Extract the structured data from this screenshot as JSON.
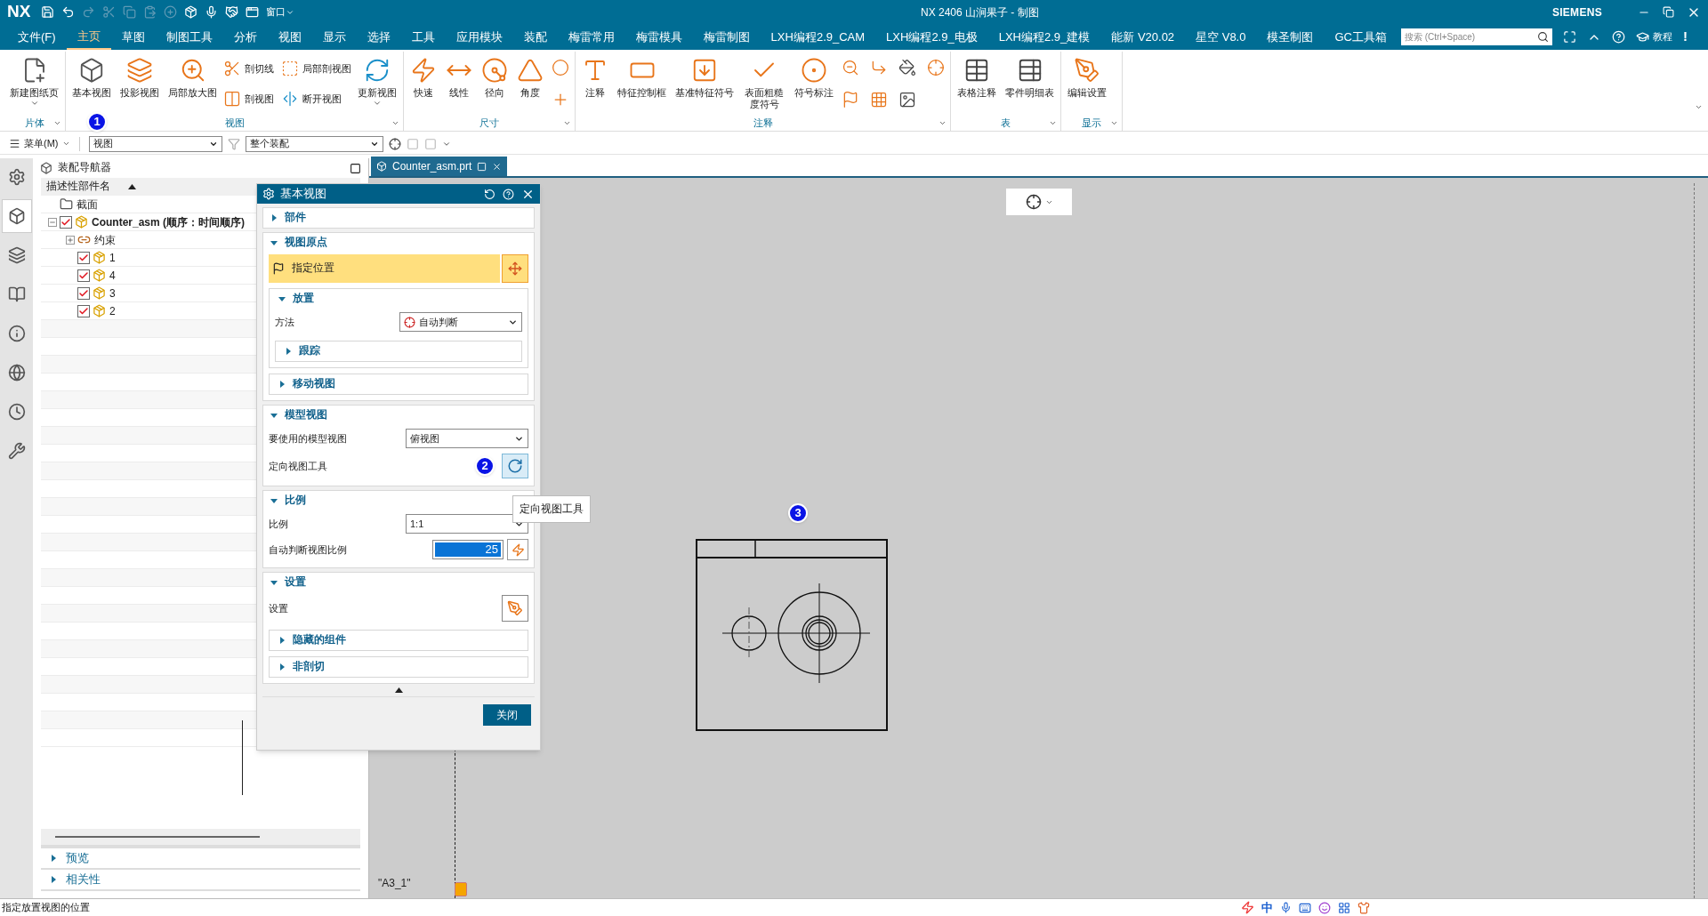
{
  "window": {
    "app": "NX",
    "title": "NX 2406 山涧果子 - 制图",
    "brand": "SIEMENS",
    "window_menu": "窗口"
  },
  "menu_bar": {
    "items": [
      {
        "label": "文件(F)",
        "selected": false
      },
      {
        "label": "主页",
        "selected": true
      },
      {
        "label": "草图",
        "selected": false
      },
      {
        "label": "制图工具",
        "selected": false
      },
      {
        "label": "分析",
        "selected": false
      },
      {
        "label": "视图",
        "selected": false
      },
      {
        "label": "显示",
        "selected": false
      },
      {
        "label": "选择",
        "selected": false
      },
      {
        "label": "工具",
        "selected": false
      },
      {
        "label": "应用模块",
        "selected": false
      },
      {
        "label": "装配",
        "selected": false
      },
      {
        "label": "梅雷常用",
        "selected": false
      },
      {
        "label": "梅雷模具",
        "selected": false
      },
      {
        "label": "梅雷制图",
        "selected": false
      },
      {
        "label": "LXH编程2.9_CAM",
        "selected": false
      },
      {
        "label": "LXH编程2.9_电极",
        "selected": false
      },
      {
        "label": "LXH编程2.9_建模",
        "selected": false
      },
      {
        "label": "能新 V20.02",
        "selected": false
      },
      {
        "label": "星空 V8.0",
        "selected": false
      },
      {
        "label": "模圣制图",
        "selected": false
      },
      {
        "label": "GC工具箱",
        "selected": false
      }
    ],
    "search": {
      "placeholder": "搜索 (Ctrl+Space)"
    },
    "help_label": "教程",
    "notice": "!"
  },
  "ribbon": {
    "groups": [
      {
        "label": "片体",
        "buttons": [
          {
            "label": "新建图纸页",
            "kind": "large",
            "menu": true
          }
        ]
      },
      {
        "label": "视图",
        "buttons": [
          {
            "label": "基本视图",
            "kind": "large",
            "callout": "1"
          },
          {
            "label": "投影视图",
            "kind": "large"
          },
          {
            "label": "局部放大图",
            "kind": "large"
          },
          {
            "label": "剖切线",
            "kind": "small"
          },
          {
            "label": "剖视图",
            "kind": "small"
          },
          {
            "label": "局部剖视图",
            "kind": "small"
          },
          {
            "label": "断开视图",
            "kind": "small"
          },
          {
            "label": "更新视图",
            "kind": "large",
            "menu": true
          }
        ]
      },
      {
        "label": "尺寸",
        "buttons": [
          {
            "label": "快速",
            "kind": "large"
          },
          {
            "label": "线性",
            "kind": "large"
          },
          {
            "label": "径向",
            "kind": "large"
          },
          {
            "label": "角度",
            "kind": "large"
          },
          {
            "kind": "icon"
          },
          {
            "kind": "icon"
          }
        ]
      },
      {
        "label": "注释",
        "buttons": [
          {
            "label": "注释",
            "kind": "large"
          },
          {
            "label": "特征控制框",
            "kind": "large"
          },
          {
            "label": "基准特征符号",
            "kind": "large"
          },
          {
            "label": "表面粗糙度符号",
            "kind": "large"
          },
          {
            "label": "符号标注",
            "kind": "large"
          },
          {
            "kind": "icon"
          },
          {
            "kind": "icon"
          },
          {
            "kind": "icon"
          },
          {
            "kind": "icon"
          },
          {
            "kind": "icon"
          },
          {
            "kind": "icon"
          },
          {
            "kind": "icon"
          }
        ]
      },
      {
        "label": "表",
        "buttons": [
          {
            "label": "表格注释",
            "kind": "large"
          },
          {
            "label": "零件明细表",
            "kind": "large"
          }
        ]
      },
      {
        "label": "显示",
        "buttons": [
          {
            "label": "编辑设置",
            "kind": "large"
          }
        ]
      }
    ]
  },
  "toolbar": {
    "menu": "菜单(M)",
    "filter": "视图",
    "scope": "整个装配"
  },
  "side_tabs": [
    {
      "selected": false
    },
    {
      "selected": true
    },
    {
      "selected": false
    },
    {
      "selected": false
    },
    {
      "selected": false
    },
    {
      "selected": false
    },
    {
      "selected": false
    },
    {
      "selected": false
    }
  ],
  "navigator": {
    "title": "装配导航器",
    "column": "描述性部件名",
    "tree": [
      {
        "label": "截面",
        "kind": "folder"
      },
      {
        "label": "Counter_asm  (顺序：时间顺序)",
        "kind": "assembly",
        "checked": true,
        "expanded": true,
        "children": [
          {
            "label": "约束",
            "kind": "constraints",
            "expanded": false
          },
          {
            "label": "1",
            "kind": "part",
            "checked": true
          },
          {
            "label": "4",
            "kind": "part",
            "checked": true
          },
          {
            "label": "3",
            "kind": "part",
            "checked": true
          },
          {
            "label": "2",
            "kind": "part",
            "checked": true
          }
        ]
      }
    ],
    "sections": [
      {
        "label": "预览",
        "expanded": false
      },
      {
        "label": "相关性",
        "expanded": false
      }
    ]
  },
  "document_tab": {
    "label": "Counter_asm.prt"
  },
  "dialog": {
    "title": "基本视图",
    "sections": [
      {
        "title": "部件",
        "expanded": false
      },
      {
        "title": "视图原点",
        "expanded": true,
        "rows": [
          {
            "kind": "select",
            "label": "指定位置",
            "selected": true
          },
          {
            "kind": "group",
            "title": "放置",
            "expanded": true,
            "rows": [
              {
                "kind": "dropdown",
                "label": "方法",
                "value": "自动判断"
              },
              {
                "kind": "group",
                "title": "跟踪",
                "expanded": false
              }
            ]
          },
          {
            "kind": "group",
            "title": "移动视图",
            "expanded": false
          }
        ]
      },
      {
        "title": "模型视图",
        "expanded": true,
        "rows": [
          {
            "kind": "dropdown",
            "label": "要使用的模型视图",
            "value": "俯视图"
          },
          {
            "kind": "tool",
            "label": "定向视图工具",
            "callout": "2"
          }
        ]
      },
      {
        "title": "比例",
        "expanded": true,
        "rows": [
          {
            "kind": "dropdown",
            "label": "比例",
            "value": "1:1"
          },
          {
            "kind": "number",
            "label": "自动判断视图比例",
            "value": "25"
          }
        ]
      },
      {
        "title": "设置",
        "expanded": true,
        "rows": [
          {
            "kind": "button",
            "label": "设置"
          },
          {
            "kind": "group",
            "title": "隐藏的组件",
            "expanded": false
          },
          {
            "kind": "group",
            "title": "非剖切",
            "expanded": false
          }
        ]
      }
    ],
    "close": "关闭"
  },
  "tooltip": "定向视图工具",
  "canvas": {
    "sheet_label": "\"A3_1\"",
    "callout": "3"
  },
  "status_bar": {
    "message": "指定放置视图的位置",
    "ime": "中"
  }
}
